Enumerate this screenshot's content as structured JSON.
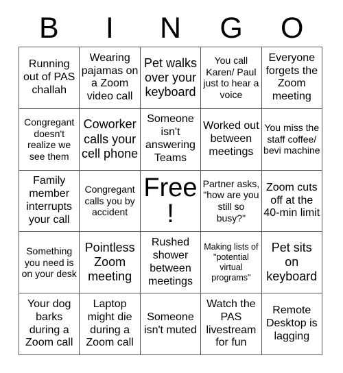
{
  "header": {
    "letters": [
      "B",
      "I",
      "N",
      "G",
      "O"
    ]
  },
  "grid": {
    "rows": [
      [
        {
          "text": "Running out of PAS challah",
          "size": "fs-m"
        },
        {
          "text": "Wearing pajamas on a Zoom video call",
          "size": "fs-m"
        },
        {
          "text": "Pet walks over your keyboard",
          "size": "fs-l"
        },
        {
          "text": "You call Karen/ Paul just to hear a voice",
          "size": "fs-s"
        },
        {
          "text": "Everyone forgets the Zoom meeting",
          "size": "fs-m"
        }
      ],
      [
        {
          "text": "Congregant doesn't realize we see them",
          "size": "fs-s"
        },
        {
          "text": "Coworker calls your cell phone",
          "size": "fs-l"
        },
        {
          "text": "Someone isn't answering Teams",
          "size": "fs-m"
        },
        {
          "text": "Worked out between meetings",
          "size": "fs-m"
        },
        {
          "text": "You miss the staff coffee/ bevi machine",
          "size": "fs-s"
        }
      ],
      [
        {
          "text": "Family member interrupts your call",
          "size": "fs-m"
        },
        {
          "text": "Congregant calls you by accident",
          "size": "fs-s"
        },
        {
          "text": "Free!",
          "size": "fs-free"
        },
        {
          "text": "Partner asks, \"how are you still so busy?\"",
          "size": "fs-s"
        },
        {
          "text": "Zoom cuts off at the 40-min limit",
          "size": "fs-m"
        }
      ],
      [
        {
          "text": "Something you need is on your desk",
          "size": "fs-s"
        },
        {
          "text": "Pointless Zoom meeting",
          "size": "fs-l"
        },
        {
          "text": "Rushed shower between meetings",
          "size": "fs-m"
        },
        {
          "text": "Making lists of \"potential virtual programs\"",
          "size": "fs-xs"
        },
        {
          "text": "Pet sits on keyboard",
          "size": "fs-l"
        }
      ],
      [
        {
          "text": "Your dog barks during a Zoom call",
          "size": "fs-m"
        },
        {
          "text": "Laptop might die during a Zoom call",
          "size": "fs-m"
        },
        {
          "text": "Someone isn't muted",
          "size": "fs-m"
        },
        {
          "text": "Watch the PAS livestream for fun",
          "size": "fs-m"
        },
        {
          "text": "Remote Desktop is lagging",
          "size": "fs-m"
        }
      ]
    ]
  },
  "colors": {
    "border": "#555555",
    "text": "#000000",
    "background": "#ffffff"
  }
}
